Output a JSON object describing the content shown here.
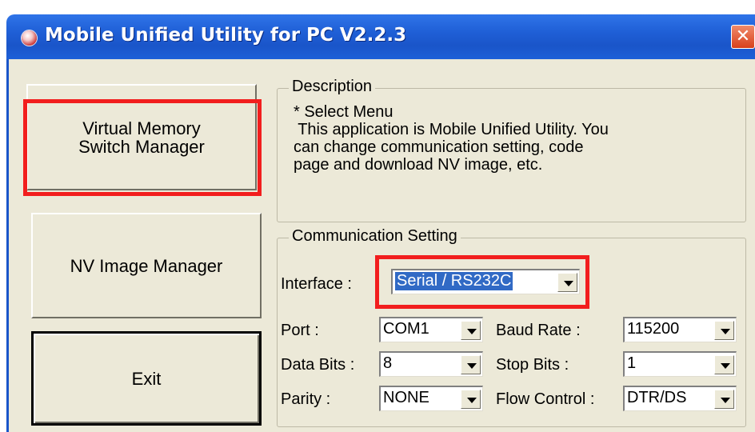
{
  "window": {
    "title": "Mobile Unified Utility for PC V2.2.3",
    "close_glyph": "✕"
  },
  "buttons": {
    "virtual_memory_line1": "Virtual Memory",
    "virtual_memory_line2": "Switch Manager",
    "nv_image": "NV Image Manager",
    "exit": "Exit"
  },
  "description": {
    "legend": "Description",
    "text": "* Select Menu\n This application is Mobile Unified Utility. You\ncan change communication setting, code\npage and download NV image, etc."
  },
  "communication": {
    "legend": "Communication Setting",
    "interface": {
      "label": "Interface :",
      "value": "Serial / RS232C"
    },
    "port": {
      "label": "Port :",
      "value": "COM1"
    },
    "baud_rate": {
      "label": "Baud Rate :",
      "value": "115200"
    },
    "data_bits": {
      "label": "Data Bits :",
      "value": "8"
    },
    "stop_bits": {
      "label": "Stop Bits :",
      "value": "1"
    },
    "parity": {
      "label": "Parity :",
      "value": "NONE"
    },
    "flow_control": {
      "label": "Flow Control :",
      "value": "DTR/DS"
    }
  },
  "colors": {
    "titlebar": "#1f5fd6",
    "highlight": "#f21e1e",
    "face": "#ece9d8",
    "selection": "#316ac5"
  },
  "icons": [
    "app-icon",
    "close-icon",
    "dropdown-arrow-icon"
  ]
}
